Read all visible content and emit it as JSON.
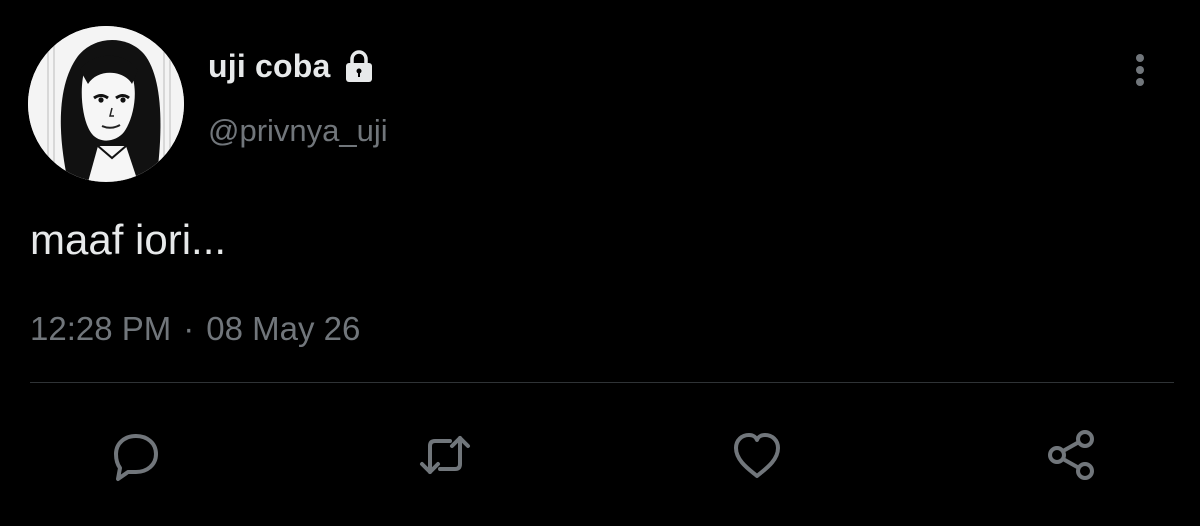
{
  "tweet": {
    "display_name": "uji coba",
    "handle": "@privnya_uji",
    "text": "maaf iori...",
    "time": "12:28 PM",
    "separator": "·",
    "date": "08 May 26",
    "protected_icon": "lock-icon",
    "more_icon": "vertical-ellipsis-icon",
    "avatar": "manga-girl-portrait"
  },
  "actions": [
    {
      "name": "reply",
      "icon": "speech-bubble-icon"
    },
    {
      "name": "retweet",
      "icon": "retweet-arrows-icon"
    },
    {
      "name": "like",
      "icon": "heart-icon"
    },
    {
      "name": "share",
      "icon": "share-nodes-icon"
    }
  ],
  "colors": {
    "background": "#000000",
    "primary_text": "#e7e9ea",
    "secondary_text": "#71767b",
    "icon": "#71767b",
    "divider": "#2f3336"
  }
}
